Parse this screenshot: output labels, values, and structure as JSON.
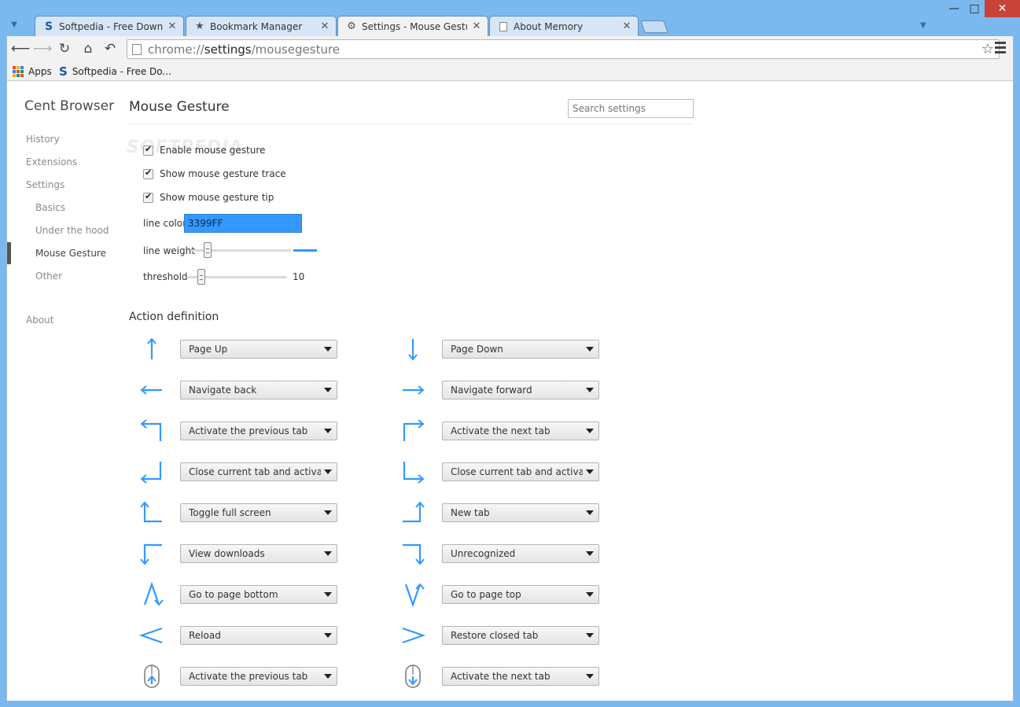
{
  "window": {
    "minimize_label": "—",
    "maximize_label": "□",
    "close_label": "✕"
  },
  "tabs": [
    {
      "title": "Softpedia - Free Downloads",
      "icon": "softpedia-icon"
    },
    {
      "title": "Bookmark Manager",
      "icon": "star-icon"
    },
    {
      "title": "Settings - Mouse Gesture",
      "icon": "gear-icon"
    },
    {
      "title": "About Memory",
      "icon": "page-icon"
    }
  ],
  "toolbar": {
    "url_prefix": "chrome://",
    "url_host": "settings",
    "url_path": "/mousegesture"
  },
  "bookmarks": [
    {
      "label": "Apps"
    },
    {
      "label": "Softpedia - Free Do..."
    }
  ],
  "sidebar": {
    "title": "Cent Browser",
    "items": [
      {
        "label": "History"
      },
      {
        "label": "Extensions"
      },
      {
        "label": "Settings"
      },
      {
        "label": "Basics"
      },
      {
        "label": "Under the hood"
      },
      {
        "label": "Mouse Gesture"
      },
      {
        "label": "Other"
      },
      {
        "label": "About"
      }
    ]
  },
  "main": {
    "title": "Mouse Gesture",
    "search_placeholder": "Search settings",
    "watermark": "SOFTPEDIA",
    "checkboxes": [
      {
        "label": "Enable mouse gesture",
        "checked": true
      },
      {
        "label": "Show mouse gesture trace",
        "checked": true
      },
      {
        "label": "Show mouse gesture tip",
        "checked": true
      }
    ],
    "line_color_label": "line color",
    "line_color_value": "3399FF",
    "line_color": "#3399ff",
    "line_weight_label": "line weight",
    "threshold_label": "threshold",
    "threshold_value": "10",
    "action_title": "Action definition",
    "actions_left": [
      {
        "gesture": "up",
        "label": "Page Up"
      },
      {
        "gesture": "left",
        "label": "Navigate back"
      },
      {
        "gesture": "up-left",
        "label": "Activate the previous tab"
      },
      {
        "gesture": "down-left",
        "label": "Close current tab and activate the previous tab"
      },
      {
        "gesture": "left-up",
        "label": "Toggle full screen"
      },
      {
        "gesture": "left-down",
        "label": "View downloads"
      },
      {
        "gesture": "up-down",
        "label": "Go to page bottom"
      },
      {
        "gesture": "left-right",
        "label": "Reload"
      },
      {
        "gesture": "wheel-up",
        "label": "Activate the previous tab"
      }
    ],
    "actions_right": [
      {
        "gesture": "down",
        "label": "Page Down"
      },
      {
        "gesture": "right",
        "label": "Navigate forward"
      },
      {
        "gesture": "up-right",
        "label": "Activate the next tab"
      },
      {
        "gesture": "down-right",
        "label": "Close current tab and activate the next tab"
      },
      {
        "gesture": "right-up",
        "label": "New tab"
      },
      {
        "gesture": "right-down",
        "label": "Unrecognized"
      },
      {
        "gesture": "down-up",
        "label": "Go to page top"
      },
      {
        "gesture": "right-left",
        "label": "Restore closed tab"
      },
      {
        "gesture": "wheel-down",
        "label": "Activate the next tab"
      }
    ]
  }
}
